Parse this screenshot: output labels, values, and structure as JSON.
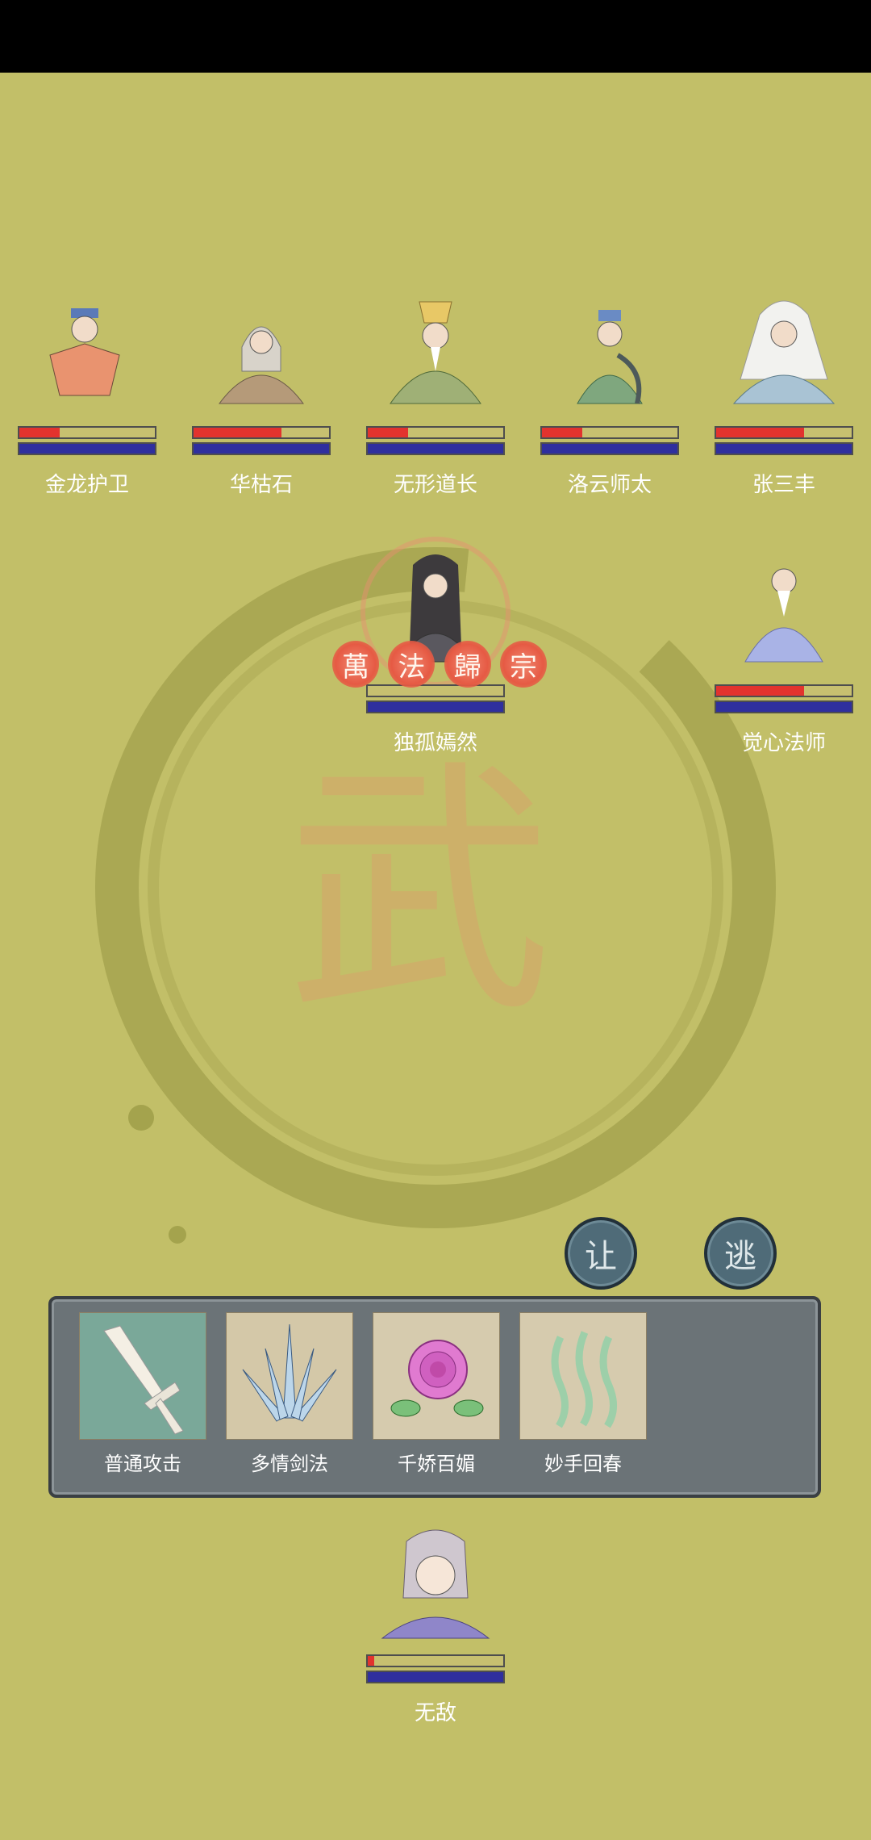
{
  "colors": {
    "background": "#c2bf68",
    "hp": "#e2332e",
    "mp": "#2f2f9e",
    "hp_track": "#c7c070"
  },
  "enemies": [
    {
      "name": "金龙护卫",
      "hp": 0.3,
      "mp": 1.0
    },
    {
      "name": "华枯石",
      "hp": 0.65,
      "mp": 1.0
    },
    {
      "name": "无形道长",
      "hp": 0.3,
      "mp": 1.0
    },
    {
      "name": "洛云师太",
      "hp": 0.3,
      "mp": 1.0
    },
    {
      "name": "张三丰",
      "hp": 0.65,
      "mp": 1.0
    },
    {
      "name": "独孤嫣然",
      "hp": 0.0,
      "mp": 1.0
    },
    {
      "name": "觉心法师",
      "hp": 0.65,
      "mp": 1.0
    }
  ],
  "banner": {
    "chars": [
      "萬",
      "法",
      "歸",
      "宗"
    ]
  },
  "background_char": "武",
  "buttons": {
    "yield": "让",
    "flee": "逃"
  },
  "skills": [
    {
      "label": "普通攻击",
      "icon": "sword-icon"
    },
    {
      "label": "多情剑法",
      "icon": "blades-icon"
    },
    {
      "label": "千娇百媚",
      "icon": "rose-icon"
    },
    {
      "label": "妙手回春",
      "icon": "heal-waves-icon"
    }
  ],
  "player": {
    "name": "无敌",
    "hp": 0.05,
    "mp": 1.0
  }
}
